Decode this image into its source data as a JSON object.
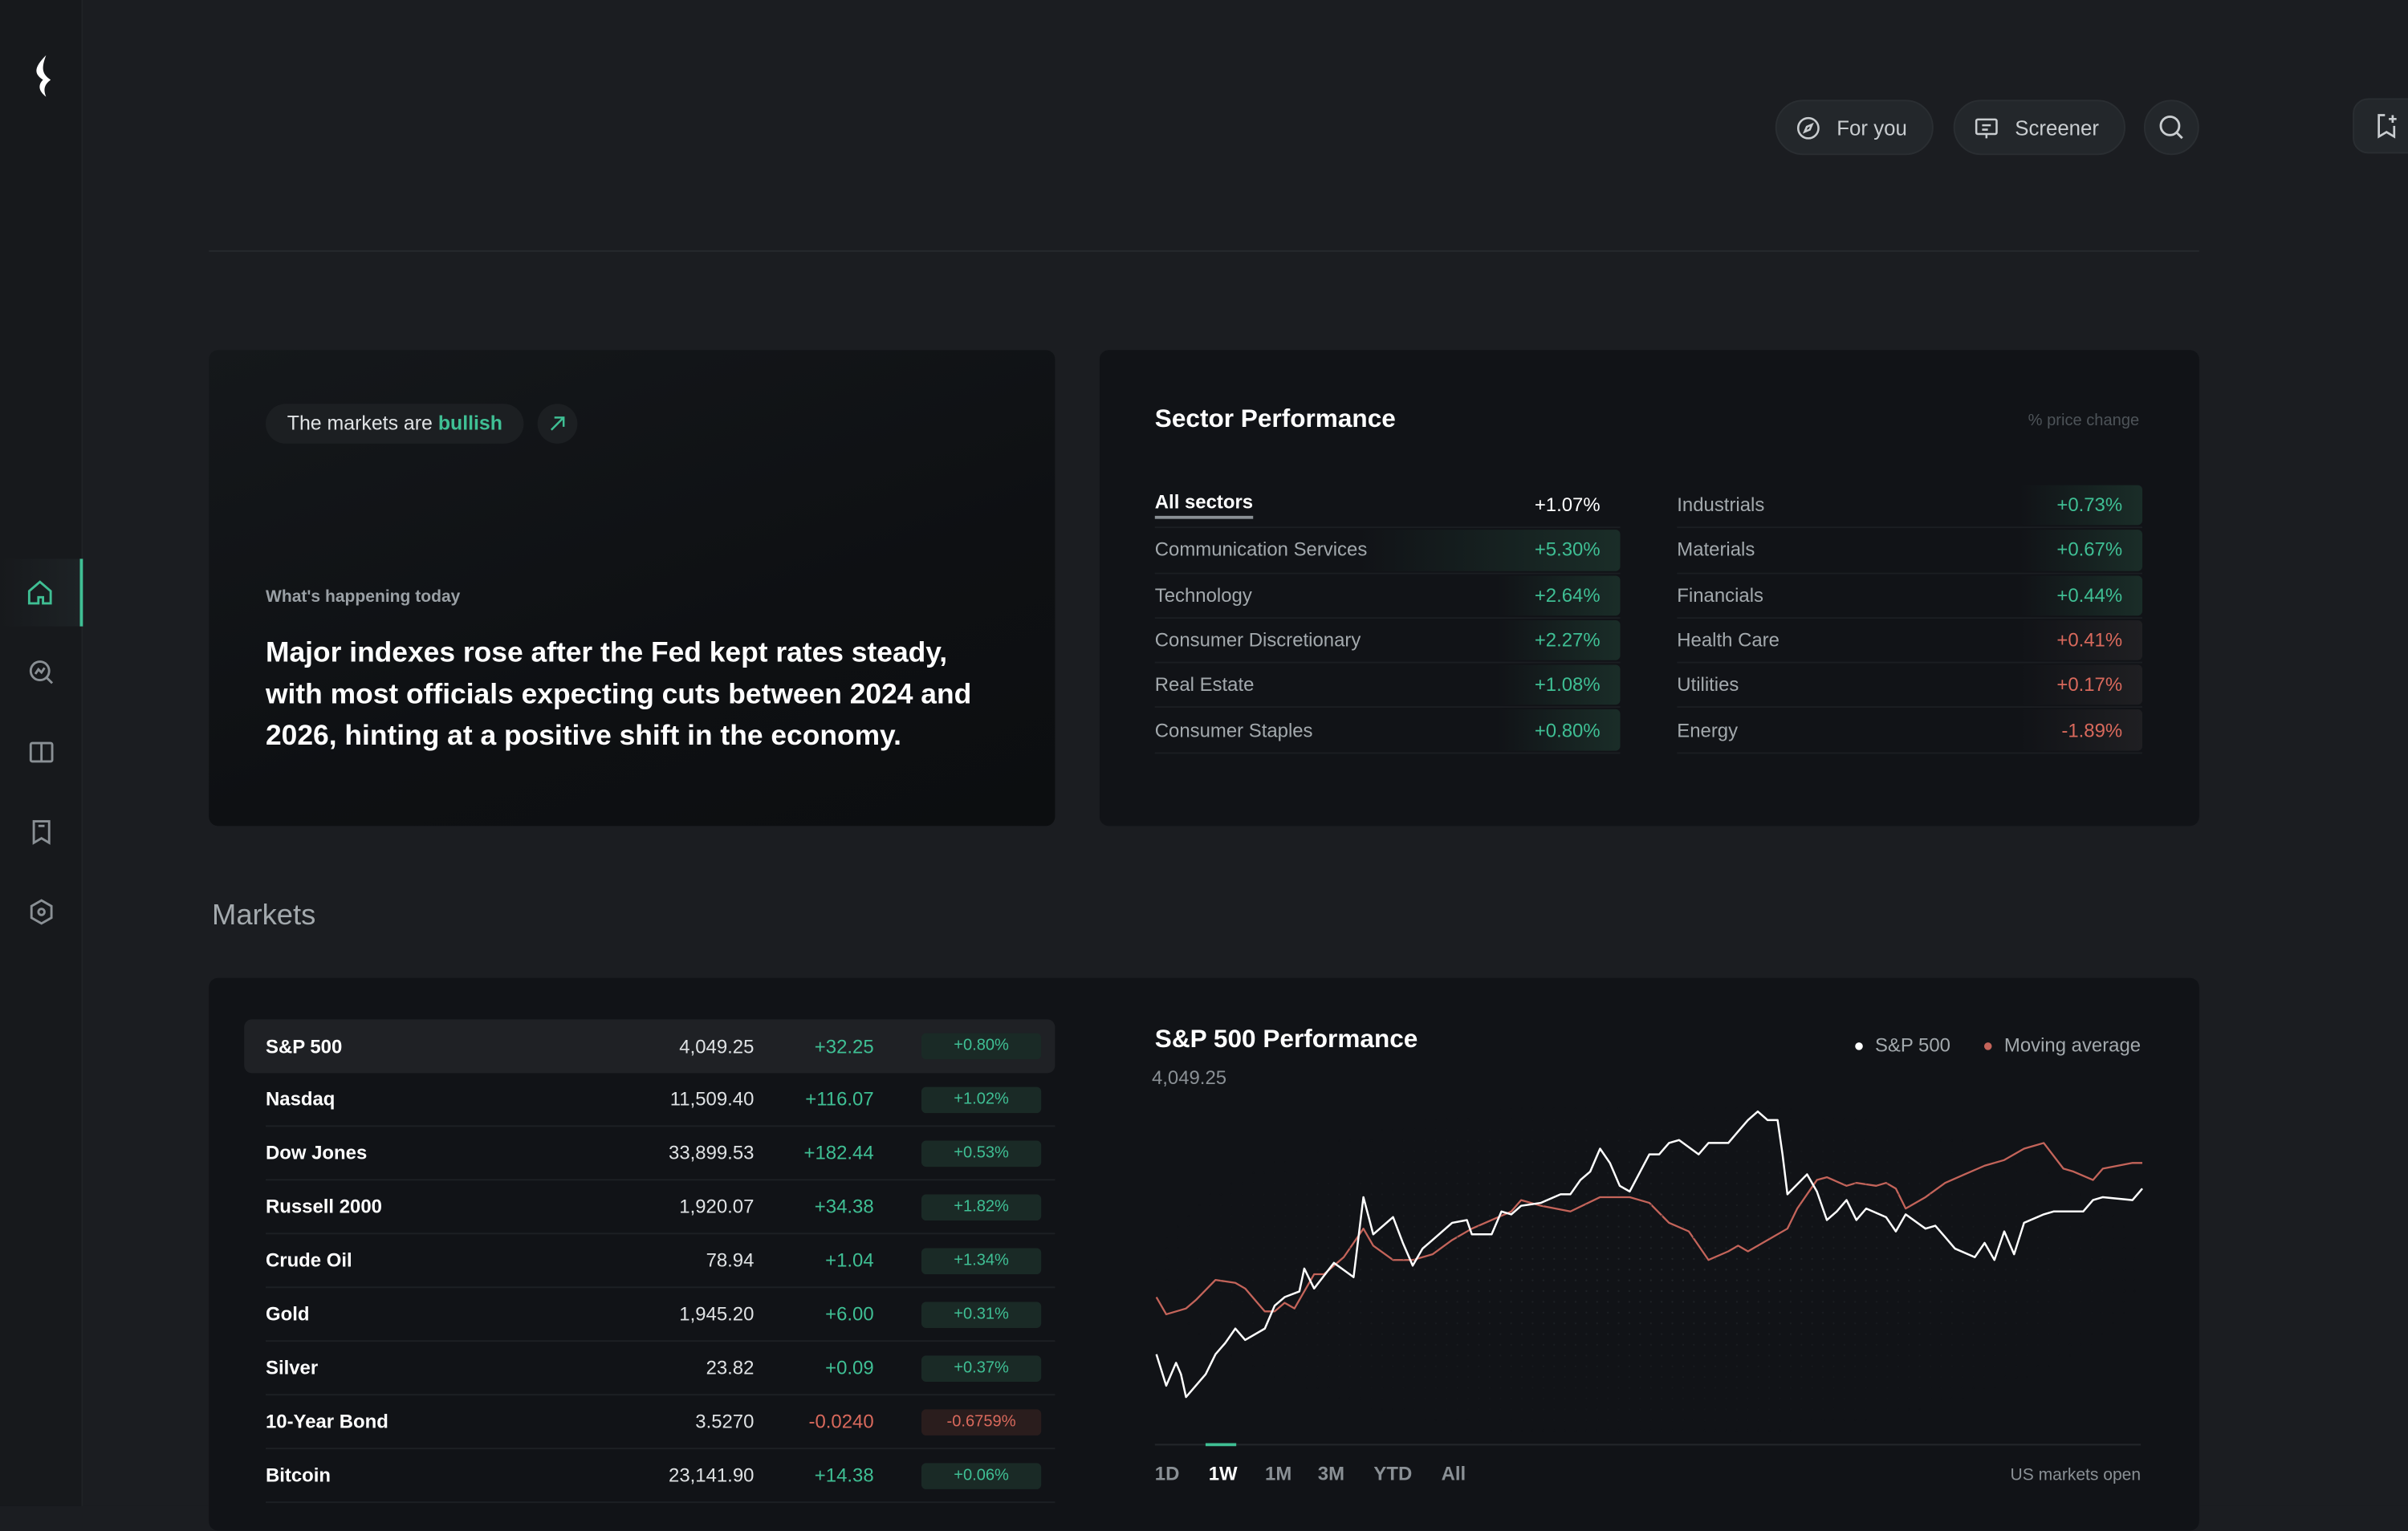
{
  "sidebar": {
    "items": [
      {
        "icon": "home-icon",
        "label": "Home",
        "active": true
      },
      {
        "icon": "chart-search-icon",
        "label": "Explore"
      },
      {
        "icon": "book-icon",
        "label": "Learn"
      },
      {
        "icon": "bookmark-icon",
        "label": "Watchlist"
      },
      {
        "icon": "settings-icon",
        "label": "Settings"
      }
    ]
  },
  "header": {
    "for_you": "For you",
    "screener": "Screener"
  },
  "news": {
    "badge_prefix": "The markets are",
    "badge_sentiment": "bullish",
    "kicker": "What's happening today",
    "headline": "Major indexes rose after the Fed kept rates steady, with most officials expecting cuts between 2024 and 2026, hinting at a positive shift in the economy."
  },
  "sector": {
    "title": "Sector Performance",
    "note": "% price change",
    "left": [
      {
        "name": "All sectors",
        "value": "+1.07%",
        "trend": "all"
      },
      {
        "name": "Communication Services",
        "value": "+5.30%",
        "trend": "pos"
      },
      {
        "name": "Technology",
        "value": "+2.64%",
        "trend": "pos"
      },
      {
        "name": "Consumer Discretionary",
        "value": "+2.27%",
        "trend": "pos"
      },
      {
        "name": "Real Estate",
        "value": "+1.08%",
        "trend": "pos"
      },
      {
        "name": "Consumer Staples",
        "value": "+0.80%",
        "trend": "pos"
      }
    ],
    "right": [
      {
        "name": "Industrials",
        "value": "+0.73%",
        "trend": "pos"
      },
      {
        "name": "Materials",
        "value": "+0.67%",
        "trend": "pos"
      },
      {
        "name": "Financials",
        "value": "+0.44%",
        "trend": "pos"
      },
      {
        "name": "Health Care",
        "value": "+0.41%",
        "trend": "neg"
      },
      {
        "name": "Utilities",
        "value": "+0.17%",
        "trend": "neg"
      },
      {
        "name": "Energy",
        "value": "-1.89%",
        "trend": "neg"
      }
    ]
  },
  "markets": {
    "label": "Markets",
    "rows": [
      {
        "name": "S&P 500",
        "price": "4,049.25",
        "change": "+32.25",
        "pct": "+0.80%",
        "trend": "pos"
      },
      {
        "name": "Nasdaq",
        "price": "11,509.40",
        "change": "+116.07",
        "pct": "+1.02%",
        "trend": "pos"
      },
      {
        "name": "Dow Jones",
        "price": "33,899.53",
        "change": "+182.44",
        "pct": "+0.53%",
        "trend": "pos"
      },
      {
        "name": "Russell 2000",
        "price": "1,920.07",
        "change": "+34.38",
        "pct": "+1.82%",
        "trend": "pos"
      },
      {
        "name": "Crude Oil",
        "price": "78.94",
        "change": "+1.04",
        "pct": "+1.34%",
        "trend": "pos"
      },
      {
        "name": "Gold",
        "price": "1,945.20",
        "change": "+6.00",
        "pct": "+0.31%",
        "trend": "pos"
      },
      {
        "name": "Silver",
        "price": "23.82",
        "change": "+0.09",
        "pct": "+0.37%",
        "trend": "pos"
      },
      {
        "name": "10-Year Bond",
        "price": "3.5270",
        "change": "-0.0240",
        "pct": "-0.6759%",
        "trend": "neg"
      },
      {
        "name": "Bitcoin",
        "price": "23,141.90",
        "change": "+14.38",
        "pct": "+0.06%",
        "trend": "pos"
      }
    ]
  },
  "colors": {
    "positive": "#3fbf94",
    "negative": "#d9695c",
    "accent": "#3fbf94"
  },
  "chart_data": {
    "type": "line",
    "title": "S&P 500 Performance",
    "subtitle": "4,049.25",
    "legend_placement": "top-right",
    "grid": false,
    "ranges": [
      "1D",
      "1W",
      "1M",
      "3M",
      "YTD",
      "All"
    ],
    "selected_range": "1W",
    "status": "US markets open",
    "series": [
      {
        "name": "S&P 500",
        "color": "#ffffff",
        "points": [
          [
            0,
            15
          ],
          [
            1,
            4
          ],
          [
            2,
            12
          ],
          [
            2.5,
            8
          ],
          [
            3,
            0
          ],
          [
            5,
            8
          ],
          [
            6,
            15
          ],
          [
            7,
            19
          ],
          [
            8,
            24
          ],
          [
            9,
            20
          ],
          [
            11,
            24
          ],
          [
            12,
            32
          ],
          [
            13,
            35
          ],
          [
            14.5,
            37
          ],
          [
            15,
            45
          ],
          [
            16,
            38
          ],
          [
            18,
            47
          ],
          [
            20,
            42
          ],
          [
            21,
            70
          ],
          [
            22,
            57
          ],
          [
            24,
            63
          ],
          [
            25,
            54
          ],
          [
            26,
            46
          ],
          [
            27,
            52
          ],
          [
            28,
            55
          ],
          [
            30,
            61
          ],
          [
            31.5,
            62
          ],
          [
            32,
            57
          ],
          [
            34,
            57
          ],
          [
            35,
            65
          ],
          [
            36,
            64
          ],
          [
            37,
            67
          ],
          [
            39,
            68
          ],
          [
            41,
            71
          ],
          [
            42,
            71
          ],
          [
            43,
            76
          ],
          [
            44,
            79
          ],
          [
            45,
            87
          ],
          [
            46,
            82
          ],
          [
            47,
            74
          ],
          [
            48,
            72
          ],
          [
            50,
            85
          ],
          [
            51,
            85
          ],
          [
            52,
            89
          ],
          [
            53,
            90
          ],
          [
            55,
            85
          ],
          [
            56,
            89
          ],
          [
            58,
            89
          ],
          [
            59,
            93
          ],
          [
            60,
            97
          ],
          [
            61,
            100
          ],
          [
            62,
            97
          ],
          [
            63,
            97
          ],
          [
            63.5,
            85
          ],
          [
            64,
            71
          ],
          [
            66,
            78
          ],
          [
            67,
            72
          ],
          [
            68,
            62
          ],
          [
            69,
            65
          ],
          [
            70,
            69
          ],
          [
            71,
            62
          ],
          [
            72,
            66
          ],
          [
            74,
            63
          ],
          [
            75,
            58
          ],
          [
            76,
            64
          ],
          [
            78,
            59
          ],
          [
            79,
            60
          ],
          [
            80,
            56
          ],
          [
            81,
            52
          ],
          [
            83,
            49
          ],
          [
            84,
            54
          ],
          [
            85,
            48
          ],
          [
            86,
            58
          ],
          [
            87,
            50
          ],
          [
            88,
            61
          ],
          [
            90,
            64
          ],
          [
            91,
            65
          ],
          [
            93,
            65
          ],
          [
            94,
            65
          ],
          [
            95,
            69
          ],
          [
            96,
            70
          ],
          [
            99,
            69
          ],
          [
            100,
            73
          ]
        ]
      },
      {
        "name": "Moving average",
        "color": "#c4645a",
        "points": [
          [
            0,
            35
          ],
          [
            1,
            29
          ],
          [
            3,
            31
          ],
          [
            4,
            34
          ],
          [
            6,
            41
          ],
          [
            8,
            40
          ],
          [
            9,
            38
          ],
          [
            11,
            30
          ],
          [
            12,
            30
          ],
          [
            13,
            33
          ],
          [
            14,
            31
          ],
          [
            16,
            43
          ],
          [
            17,
            43
          ],
          [
            19,
            49
          ],
          [
            20,
            54
          ],
          [
            21,
            59
          ],
          [
            22,
            53
          ],
          [
            24,
            48
          ],
          [
            26,
            48
          ],
          [
            28,
            50
          ],
          [
            30,
            55
          ],
          [
            32,
            59
          ],
          [
            34,
            62
          ],
          [
            36,
            65
          ],
          [
            37,
            69
          ],
          [
            39,
            67
          ],
          [
            42,
            65
          ],
          [
            45,
            70
          ],
          [
            48,
            70
          ],
          [
            50,
            68
          ],
          [
            52,
            61
          ],
          [
            54,
            58
          ],
          [
            56,
            48
          ],
          [
            58,
            51
          ],
          [
            59,
            53
          ],
          [
            60,
            51
          ],
          [
            62,
            55
          ],
          [
            64,
            59
          ],
          [
            65,
            66
          ],
          [
            67,
            76
          ],
          [
            68,
            77
          ],
          [
            70,
            74
          ],
          [
            71,
            75
          ],
          [
            73,
            74
          ],
          [
            74,
            75
          ],
          [
            75,
            73
          ],
          [
            76,
            66
          ],
          [
            78,
            70
          ],
          [
            80,
            75
          ],
          [
            82,
            78
          ],
          [
            84,
            81
          ],
          [
            86,
            83
          ],
          [
            88,
            87
          ],
          [
            90,
            89
          ],
          [
            92,
            80
          ],
          [
            93,
            79
          ],
          [
            95,
            76
          ],
          [
            96,
            80
          ],
          [
            99,
            82
          ],
          [
            100,
            82
          ]
        ]
      }
    ]
  }
}
